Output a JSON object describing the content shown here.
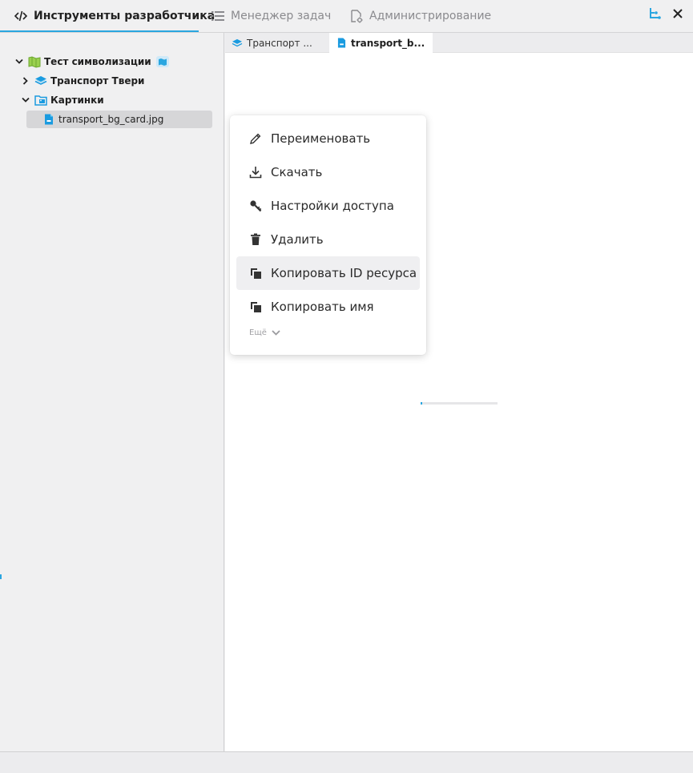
{
  "top_tabs": [
    {
      "label": "Инструменты разработчика",
      "icon": "code-icon",
      "active": true
    },
    {
      "label": "Менеджер задач",
      "icon": "list-icon",
      "active": false
    },
    {
      "label": "Администрирование",
      "icon": "settings-file-icon",
      "active": false
    }
  ],
  "tree": {
    "root": {
      "label": "Тест символизации"
    },
    "items": [
      {
        "label": "Транспорт Твери"
      },
      {
        "label": "Картинки"
      },
      {
        "label": "transport_bg_card.jpg"
      }
    ]
  },
  "editor_tabs": [
    {
      "label": "Транспорт ..."
    },
    {
      "label": "transport_b..."
    }
  ],
  "loader": {
    "progress": 0.02
  },
  "context_menu": {
    "items": [
      {
        "label": "Переименовать",
        "icon": "pencil-icon"
      },
      {
        "label": "Скачать",
        "icon": "download-icon"
      },
      {
        "label": "Настройки доступа",
        "icon": "key-icon"
      },
      {
        "label": "Удалить",
        "icon": "trash-icon"
      },
      {
        "label": "Копировать ID ресурса",
        "icon": "copy-icon"
      },
      {
        "label": "Копировать имя",
        "icon": "copy-icon"
      }
    ],
    "more_label": "Ещё"
  },
  "colors": {
    "accent": "#2aa6e0",
    "map_icon": "#7cbf3c",
    "layer_icon": "#1a9be0"
  }
}
